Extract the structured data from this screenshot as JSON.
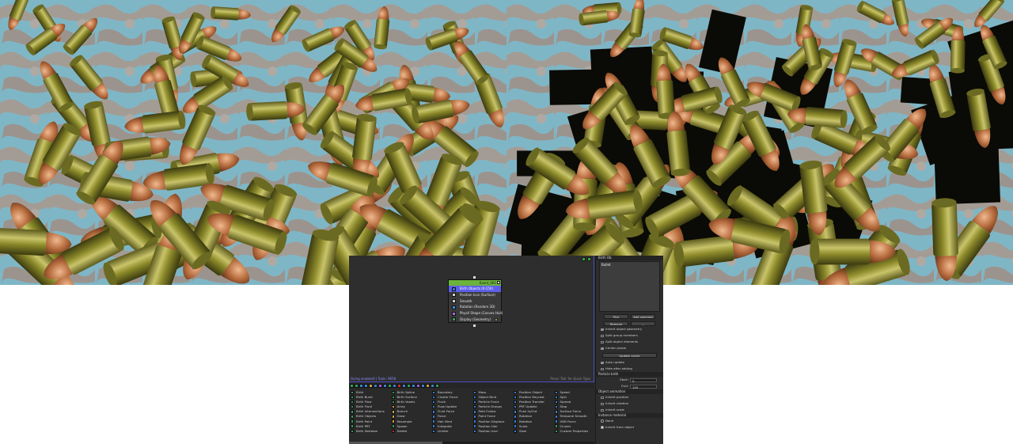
{
  "editor": {
    "graph": {
      "status_left": "[tying enabled] | Tools: 9658",
      "status_right": "Press 'Tab' for Quick Type"
    },
    "event": {
      "title": "Event_001",
      "operators": [
        {
          "label": "Birth Objects (0-150)",
          "selected": true,
          "icon_color": "#3a7bd5"
        },
        {
          "label": "Position Icon (Surface)",
          "selected": false,
          "icon_color": "#d0d0d0"
        },
        {
          "label": "Smooth",
          "selected": false,
          "icon_color": "#d0d0d0"
        },
        {
          "label": "Rotation (Random 3D)",
          "selected": false,
          "icon_color": "#3c8fd8"
        },
        {
          "label": "PhysX Shape (Convex Hull)",
          "selected": false,
          "icon_color": "#a06be0"
        },
        {
          "label": "Display (Geometry)",
          "selected": false,
          "icon_color": "#3a9b5a"
        }
      ]
    },
    "depot": {
      "columns": [
        [
          {
            "label": "Birth",
            "color": "#2f9e58"
          },
          {
            "label": "Birth Burst",
            "color": "#2f9e58"
          },
          {
            "label": "Birth Flow",
            "color": "#2f9e58"
          },
          {
            "label": "Birth Fluid",
            "color": "#2f9e58"
          },
          {
            "label": "Birth Intersections",
            "color": "#2f9e58"
          },
          {
            "label": "Birth Objects",
            "color": "#2f9e58"
          },
          {
            "label": "Birth Paint",
            "color": "#2f9e58"
          },
          {
            "label": "Birth PRT",
            "color": "#2f9e58"
          },
          {
            "label": "Birth Skeleton",
            "color": "#2f9e58"
          }
        ],
        [
          {
            "label": "Birth Spline",
            "color": "#2f9e58"
          },
          {
            "label": "Birth Surface",
            "color": "#2f9e58"
          },
          {
            "label": "Birth Voxels",
            "color": "#2f9e58"
          },
          {
            "label": "Array",
            "color": "#d0a040"
          },
          {
            "label": "Branch",
            "color": "#d0a040"
          },
          {
            "label": "Grow",
            "color": "#d0a040"
          },
          {
            "label": "Resample",
            "color": "#d0a040"
          },
          {
            "label": "Spawn",
            "color": "#2f9e58"
          },
          {
            "label": "Delete",
            "color": "#c03030"
          }
        ],
        [
          {
            "label": "Boundary",
            "color": "#3b7fd0"
          },
          {
            "label": "Cluster Force",
            "color": "#3b7fd0"
          },
          {
            "label": "Flock",
            "color": "#3b7fd0"
          },
          {
            "label": "Flow Update",
            "color": "#3b7fd0"
          },
          {
            "label": "Fluid Force",
            "color": "#3b7fd0"
          },
          {
            "label": "Force",
            "color": "#3b7fd0"
          },
          {
            "label": "Hair Bind",
            "color": "#3b7fd0"
          },
          {
            "label": "Integrate",
            "color": "#3b7fd0"
          },
          {
            "label": "Limiter",
            "color": "#3b7fd0"
          }
        ],
        [
          {
            "label": "Mass",
            "color": "#3b7fd0"
          },
          {
            "label": "Object Bind",
            "color": "#3b7fd0"
          },
          {
            "label": "Particle Force",
            "color": "#3b7fd0"
          },
          {
            "label": "Particle Groups",
            "color": "#3b7fd0"
          },
          {
            "label": "Path Follow",
            "color": "#3b7fd0"
          },
          {
            "label": "Point Force",
            "color": "#3b7fd0"
          },
          {
            "label": "Position Displace",
            "color": "#3b7fd0"
          },
          {
            "label": "Position Hair",
            "color": "#3b7fd0"
          },
          {
            "label": "Position Icon",
            "color": "#3b7fd0"
          }
        ],
        [
          {
            "label": "Position Object",
            "color": "#3b7fd0"
          },
          {
            "label": "Position Raycast",
            "color": "#3b7fd0"
          },
          {
            "label": "Position Transfer",
            "color": "#3b7fd0"
          },
          {
            "label": "PRT Update",
            "color": "#3b7fd0"
          },
          {
            "label": "Push In/Out",
            "color": "#3b7fd0"
          },
          {
            "label": "Rotation",
            "color": "#3b7fd0"
          },
          {
            "label": "Rotation",
            "color": "#3b7fd0"
          },
          {
            "label": "Scale",
            "color": "#3b7fd0"
          },
          {
            "label": "Slow",
            "color": "#3b7fd0"
          }
        ],
        [
          {
            "label": "Speed",
            "color": "#3b7fd0"
          },
          {
            "label": "Spin",
            "color": "#3b7fd0"
          },
          {
            "label": "Spread",
            "color": "#3b7fd0"
          },
          {
            "label": "Stop",
            "color": "#3b7fd0"
          },
          {
            "label": "Surface Force",
            "color": "#3b7fd0"
          },
          {
            "label": "Temporal Smooth",
            "color": "#3b7fd0"
          },
          {
            "label": "VDB Force",
            "color": "#3b7fd0"
          },
          {
            "label": "Cluster",
            "color": "#3a9b5a"
          },
          {
            "label": "Custom Properties",
            "color": "#3a9b5a"
          }
        ]
      ]
    },
    "side": {
      "header_top": "Birth Ob",
      "object_list": [
        "Bullet"
      ],
      "pick_label": "Pick",
      "add_selected_label": "Add selected",
      "remove_label": "Remove",
      "clear_label": "...",
      "checks": [
        {
          "label": "Inherit object geometry",
          "checked": true
        },
        {
          "label": "Split group members",
          "checked": false
        },
        {
          "label": "Split object elements",
          "checked": false
        },
        {
          "label": "Center pivots",
          "checked": true
        }
      ],
      "update_cache_label": "Update cache",
      "auto_update": {
        "label": "Auto update",
        "checked": true
      },
      "hide_after_adding": {
        "label": "Hide after adding",
        "checked": false
      },
      "particle_birth_header": "Particle birth",
      "start_label": "Start:",
      "start_value": "0",
      "end_label": "End:",
      "end_value": "100",
      "object_animation_header": "Object animation",
      "anim_checks": [
        {
          "label": "Inherit position",
          "checked": false
        },
        {
          "label": "Inherit rotation",
          "checked": false
        },
        {
          "label": "Inherit scale",
          "checked": false
        }
      ],
      "instance_material_header": "Instance material",
      "material_options": [
        {
          "label": "None",
          "selected": false
        },
        {
          "label": "Inherit from object",
          "selected": true
        }
      ]
    }
  }
}
